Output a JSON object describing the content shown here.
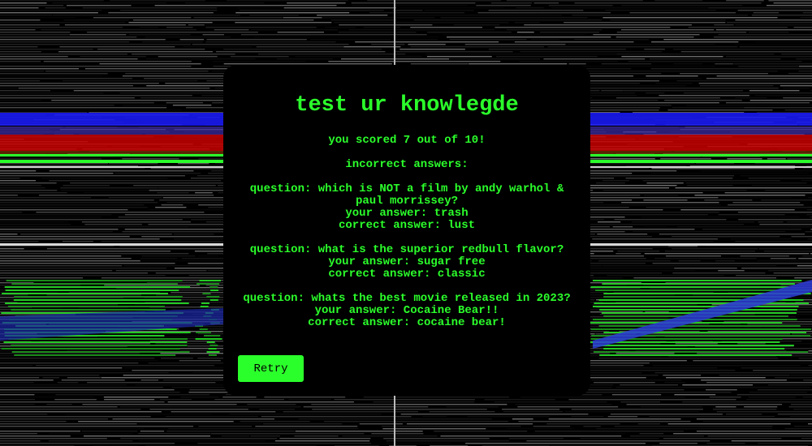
{
  "quiz": {
    "title": "test ur knowlegde",
    "score_text": "you scored 7 out of 10!",
    "incorrect_header": "incorrect answers:",
    "answers": [
      {
        "question": "question: which is NOT a film by andy warhol & paul morrissey?",
        "your_answer": "your answer: trash",
        "correct_answer": "correct answer: lust"
      },
      {
        "question": "question: what is the superior redbull flavor?",
        "your_answer": "your answer: sugar free",
        "correct_answer": "correct answer: classic"
      },
      {
        "question": "question: whats the best movie released in 2023?",
        "your_answer": "your answer: Cocaine Bear!!",
        "correct_answer": "correct answer: cocaine bear!"
      }
    ],
    "retry_label": "Retry"
  },
  "colors": {
    "accent": "#2bff2b",
    "card_background": "#000000",
    "page_background": "#000000"
  }
}
